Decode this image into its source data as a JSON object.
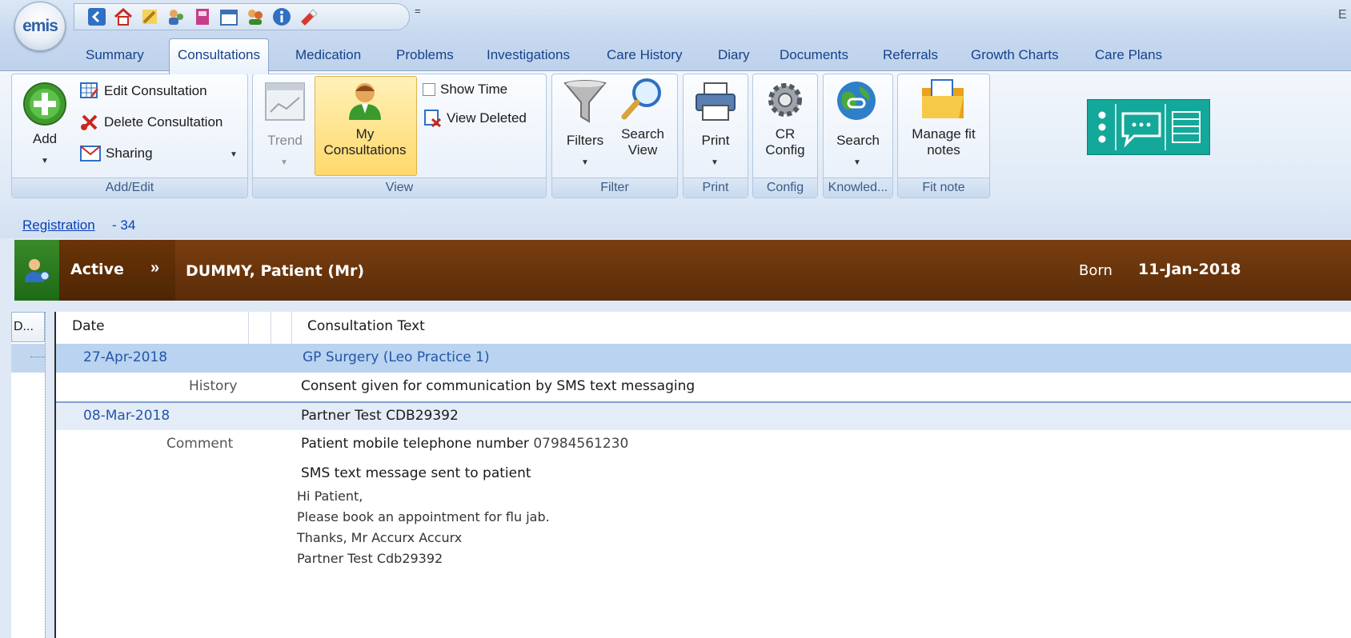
{
  "app": {
    "logo_text": "emis",
    "title_partial": "E"
  },
  "quick_access": {
    "icons": [
      "back-icon",
      "home-icon",
      "pencil-icon",
      "users-icon",
      "notebook-icon",
      "calendar-icon",
      "people-icon",
      "info-icon",
      "eraser-icon"
    ],
    "more": "="
  },
  "tabs": [
    {
      "label": "Summary",
      "active": false
    },
    {
      "label": "Consultations",
      "active": true
    },
    {
      "label": "Medication",
      "active": false
    },
    {
      "label": "Problems",
      "active": false
    },
    {
      "label": "Investigations",
      "active": false
    },
    {
      "label": "Care History",
      "active": false
    },
    {
      "label": "Diary",
      "active": false
    },
    {
      "label": "Documents",
      "active": false
    },
    {
      "label": "Referrals",
      "active": false
    },
    {
      "label": "Growth Charts",
      "active": false
    },
    {
      "label": "Care Plans",
      "active": false
    }
  ],
  "ribbon": {
    "add_edit": {
      "label": "Add/Edit",
      "add": "Add",
      "edit": "Edit Consultation",
      "delete": "Delete Consultation",
      "sharing": "Sharing"
    },
    "view": {
      "label": "View",
      "trend": "Trend",
      "my_consultations_1": "My",
      "my_consultations_2": "Consultations",
      "show_time": "Show Time",
      "view_deleted": "View Deleted"
    },
    "filter": {
      "label": "Filter",
      "filters": "Filters",
      "search_view_1": "Search",
      "search_view_2": "View"
    },
    "print": {
      "label": "Print",
      "print": "Print"
    },
    "config": {
      "label": "Config",
      "cr_1": "CR",
      "cr_2": "Config"
    },
    "knowledge": {
      "label": "Knowled...",
      "search": "Search"
    },
    "fit_note": {
      "label": "Fit note",
      "manage_1": "Manage fit",
      "manage_2": "notes"
    }
  },
  "registration": {
    "link": "Registration",
    "value": "- 34"
  },
  "patient": {
    "status": "Active",
    "name": "DUMMY, Patient (Mr)",
    "born_label": "Born",
    "born_value": "11-Jan-2018"
  },
  "grid": {
    "left_header": "D...",
    "columns": [
      "Date",
      "Consultation Text"
    ],
    "rows": [
      {
        "date": "27-Apr-2018",
        "text": "GP Surgery (Leo Practice 1)"
      },
      {
        "heading": "History",
        "text": "Consent given for communication by SMS text messaging"
      },
      {
        "date": "08-Mar-2018",
        "text": "Partner Test CDB29392"
      },
      {
        "heading": "Comment",
        "text": "Patient mobile telephone number",
        "phone": "07984561230"
      },
      {
        "text": "SMS text message sent to patient"
      }
    ],
    "sms_lines": [
      "Hi Patient,",
      "Please book an appointment for flu jab.",
      "Thanks, Mr Accurx Accurx",
      "Partner Test Cdb29392"
    ]
  },
  "colors": {
    "banner": "#5a2c08",
    "selected_row": "#b9d3f0",
    "link": "#0a3fb8",
    "accent": "#15428b"
  }
}
